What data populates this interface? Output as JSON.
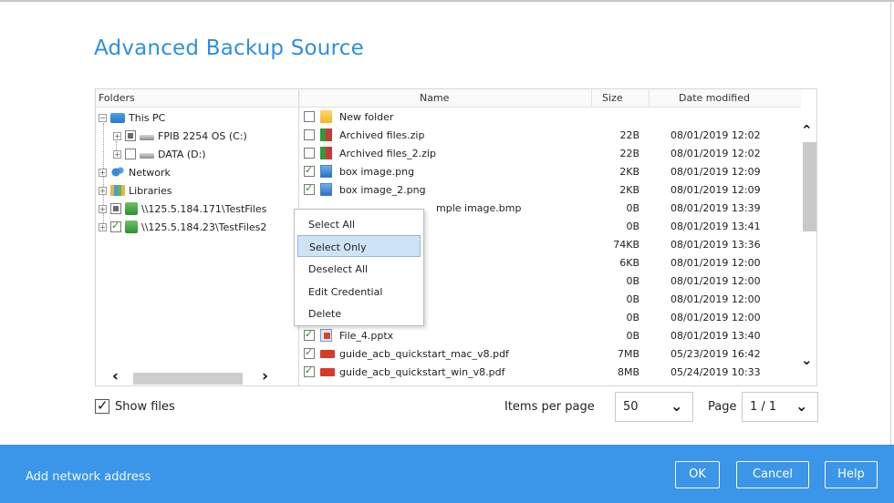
{
  "dialog": {
    "title": "Advanced Backup Source"
  },
  "tree": {
    "header": "Folders",
    "nodes": [
      {
        "label": "This PC",
        "expander": "−",
        "checkbox": "none",
        "icon": "pc-icon"
      },
      {
        "label": "FPIB 2254 OS (C:)",
        "expander": "+",
        "checkbox": "partial",
        "icon": "drive-icon"
      },
      {
        "label": "DATA (D:)",
        "expander": "+",
        "checkbox": "unchecked",
        "icon": "drive-icon"
      },
      {
        "label": "Network",
        "expander": "+",
        "checkbox": "none",
        "icon": "network-icon"
      },
      {
        "label": "Libraries",
        "expander": "+",
        "checkbox": "none",
        "icon": "libraries-icon"
      },
      {
        "label": "\\\\125.5.184.171\\TestFiles",
        "expander": "+",
        "checkbox": "partial",
        "icon": "network-share-icon"
      },
      {
        "label": "\\\\125.5.184.23\\TestFiles2",
        "expander": "+",
        "checkbox": "checked",
        "icon": "network-share-icon"
      }
    ],
    "scroll_left": "‹",
    "scroll_right": "›"
  },
  "list": {
    "columns": {
      "name": "Name",
      "size": "Size",
      "date": "Date modified"
    },
    "files": [
      {
        "name": "New folder",
        "size": "",
        "date": "",
        "checked": false,
        "type": "folder"
      },
      {
        "name": "Archived files.zip",
        "size": "22B",
        "date": "08/01/2019 12:02",
        "checked": false,
        "type": "zip"
      },
      {
        "name": "Archived files_2.zip",
        "size": "22B",
        "date": "08/01/2019 12:02",
        "checked": false,
        "type": "zip"
      },
      {
        "name": "box image.png",
        "size": "2KB",
        "date": "08/01/2019 12:09",
        "checked": true,
        "type": "image"
      },
      {
        "name": "box image_2.png",
        "size": "2KB",
        "date": "08/01/2019 12:09",
        "checked": true,
        "type": "image"
      },
      {
        "name": "mple image.bmp",
        "size": "0B",
        "date": "08/01/2019 13:39",
        "checked": false,
        "type": "hidden"
      },
      {
        "name": "",
        "size": "0B",
        "date": "08/01/2019 13:41",
        "checked": false,
        "type": "hidden"
      },
      {
        "name": "",
        "size": "74KB",
        "date": "08/01/2019 13:36",
        "checked": false,
        "type": "hidden"
      },
      {
        "name": "",
        "size": "6KB",
        "date": "08/01/2019 12:00",
        "checked": false,
        "type": "hidden"
      },
      {
        "name": "",
        "size": "0B",
        "date": "08/01/2019 12:00",
        "checked": false,
        "type": "hidden"
      },
      {
        "name": "",
        "size": "0B",
        "date": "08/01/2019 12:00",
        "checked": false,
        "type": "hidden"
      },
      {
        "name": "",
        "size": "0B",
        "date": "08/01/2019 12:00",
        "checked": false,
        "type": "hidden"
      },
      {
        "name": "File_4.pptx",
        "size": "0B",
        "date": "08/01/2019 13:40",
        "checked": true,
        "type": "ppt"
      },
      {
        "name": "guide_acb_quickstart_mac_v8.pdf",
        "size": "7MB",
        "date": "05/23/2019 16:42",
        "checked": true,
        "type": "pdf"
      },
      {
        "name": "guide_acb_quickstart_win_v8.pdf",
        "size": "8MB",
        "date": "05/24/2019 10:33",
        "checked": true,
        "type": "pdf"
      }
    ],
    "scroll_up": "⌃",
    "scroll_down": "⌄"
  },
  "context_menu": {
    "items": [
      "Select All",
      "Select Only",
      "Deselect All",
      "Edit Credential",
      "Delete"
    ],
    "highlighted": "Select Only"
  },
  "controls": {
    "show_files_label": "Show files",
    "show_files_checked": true,
    "items_per_page_label": "Items per page",
    "items_per_page_value": "50",
    "page_label": "Page",
    "page_value": "1 / 1"
  },
  "footer": {
    "link": "Add network address",
    "ok": "OK",
    "cancel": "Cancel",
    "help": "Help",
    "color": "#3b95e8"
  }
}
